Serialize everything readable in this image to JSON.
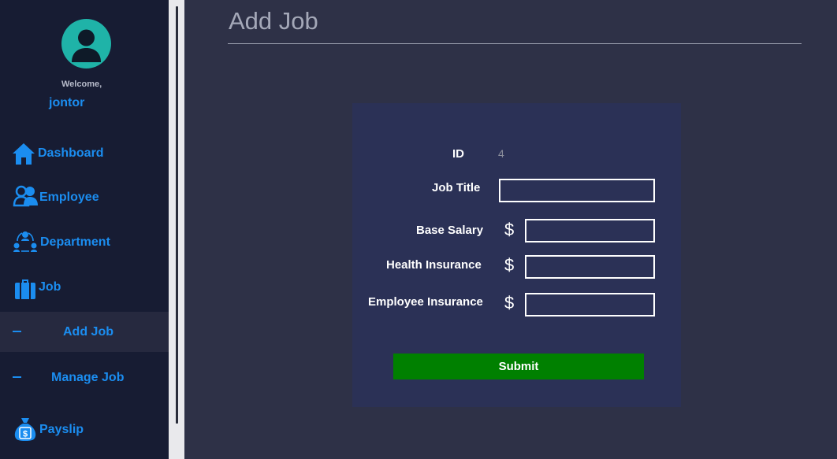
{
  "sidebar": {
    "welcome": "Welcome,",
    "username": "jontor",
    "items": [
      {
        "label": "Dashboard",
        "icon": "home-icon"
      },
      {
        "label": "Employee",
        "icon": "users-icon"
      },
      {
        "label": "Department",
        "icon": "department-icon"
      },
      {
        "label": "Job",
        "icon": "briefcase-icon"
      },
      {
        "label": "Add Job",
        "icon": "dash-icon",
        "active": true
      },
      {
        "label": "Manage Job",
        "icon": "dash-icon"
      },
      {
        "label": "Payslip",
        "icon": "money-bag-icon"
      }
    ]
  },
  "main": {
    "title": "Add Job"
  },
  "form": {
    "id_label": "ID",
    "id_value": "4",
    "job_title_label": "Job Title",
    "job_title_value": "",
    "base_salary_label": "Base Salary",
    "base_salary_value": "",
    "health_insurance_label": "Health Insurance",
    "health_insurance_value": "",
    "employee_insurance_label": "Employee Insurance",
    "employee_insurance_value": "",
    "currency_symbol": "$",
    "submit_label": "Submit"
  },
  "colors": {
    "sidebar_bg": "#171c33",
    "main_bg": "#2e3147",
    "card_bg": "#2b3156",
    "accent": "#1b8df0",
    "avatar": "#1fb3a8",
    "submit": "#008000"
  }
}
